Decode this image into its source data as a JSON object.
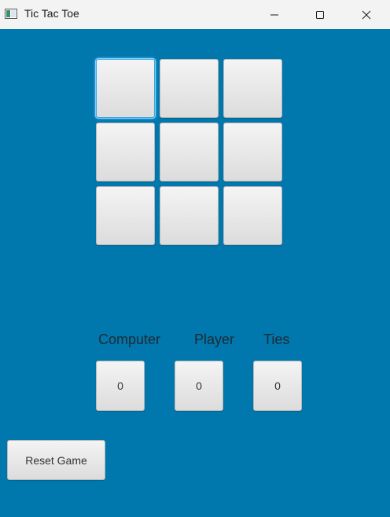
{
  "window": {
    "title": "Tic Tac Toe",
    "icon": "java-app-icon",
    "controls": [
      "minimize-icon",
      "maximize-icon",
      "close-icon"
    ]
  },
  "board": {
    "cells": [
      "",
      "",
      "",
      "",
      "",
      "",
      "",
      "",
      ""
    ],
    "focused_cell": 0
  },
  "scores": {
    "computer": {
      "label": "Computer",
      "value": "0"
    },
    "player": {
      "label": "Player",
      "value": "0"
    },
    "ties": {
      "label": "Ties",
      "value": "0"
    }
  },
  "actions": {
    "reset_label": "Reset Game"
  },
  "colors": {
    "background": "#0077ad",
    "titlebar": "#f3f3f3",
    "button_top": "#f4f4f4",
    "button_bottom": "#dcdcdc",
    "focus_ring": "#5fc0f5"
  }
}
